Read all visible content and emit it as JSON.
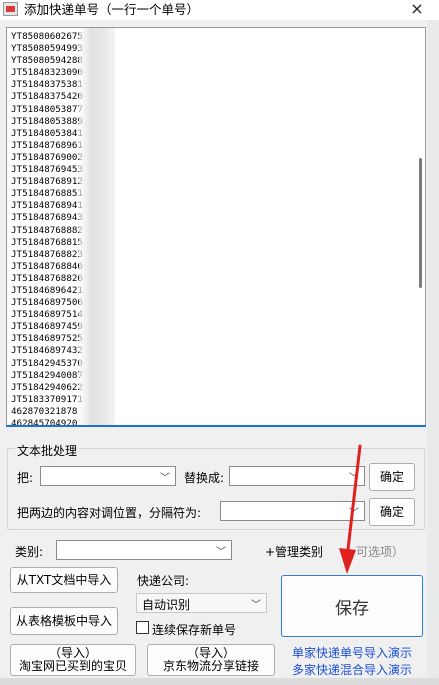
{
  "window": {
    "title": "添加快递单号（一行一个单号）",
    "close_glyph": "×"
  },
  "tracking_numbers": [
    "YT85080602675",
    "YT85080594993",
    "YT85080594288",
    "JT51848323090",
    "JT51848375381",
    "JT51848375420",
    "JT51848053877",
    "JT51848053889",
    "JT51848053841",
    "JT51848768961",
    "JT51848769002",
    "JT51848769453",
    "JT51848768912",
    "JT51848768851",
    "JT51848768941",
    "JT51848768943",
    "JT51848768882",
    "JT51848768815",
    "JT51848768823",
    "JT51848768846",
    "JT51848768826",
    "JT51846896421",
    "JT51846897506",
    "JT51846897514",
    "JT51846897459",
    "JT51846897525",
    "JT51846897432",
    "JT51842945370",
    "JT51842940087",
    "JT51842940622",
    "JT51833709171",
    "462870321878",
    "462845704920"
  ],
  "batch": {
    "group_title": "文本批处理",
    "replace_label": "把:",
    "replace_with_label": "替换成:",
    "swap_label": "把两边的内容对调位置，分隔符为:",
    "confirm_label": "确定"
  },
  "category": {
    "label": "类别:",
    "manage_label": "+管理类别",
    "optional_label": "可选项）"
  },
  "import_buttons": {
    "txt": "从TXT文档中导入",
    "table": "从表格模板中导入",
    "taobao": "（导入）\n淘宝网已买到的宝贝",
    "jd": "（导入）\n京东物流分享链接"
  },
  "courier": {
    "label": "快递公司:",
    "selected": "自动识别",
    "continuous_save_label": "连续保存新单号"
  },
  "save_label": "保存",
  "links": {
    "single_demo": "单家快递单号导入演示",
    "multi_demo": "多家快递混合导入演示"
  },
  "colors": {
    "accent": "#1e6fd6",
    "link": "#1a4fd8",
    "annotation_arrow": "#e02020"
  }
}
